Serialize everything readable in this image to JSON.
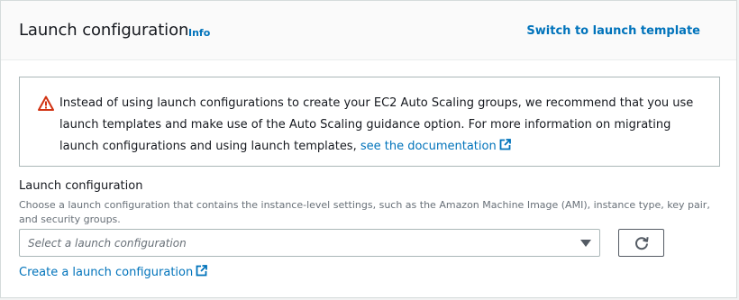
{
  "header": {
    "title": "Launch configuration",
    "info_label": "Info",
    "switch_label": "Switch to launch template"
  },
  "alert": {
    "icon": "warning-icon",
    "text": "Instead of using launch configurations to create your EC2 Auto Scaling groups, we recommend that you use launch templates and make use of the Auto Scaling guidance option. For more information on migrating launch configurations and using launch templates, ",
    "link_label": "see the documentation",
    "link_icon": "external-link-icon"
  },
  "field": {
    "label": "Launch configuration",
    "description": "Choose a launch configuration that contains the instance-level settings, such as the Amazon Machine Image (AMI), instance type, key pair, and security groups.",
    "placeholder": "Select a launch configuration",
    "refresh_icon": "refresh-icon",
    "create_link_label": "Create a launch configuration"
  },
  "colors": {
    "link": "#0073bb",
    "warning": "#d13212",
    "border": "#aab7b8"
  }
}
